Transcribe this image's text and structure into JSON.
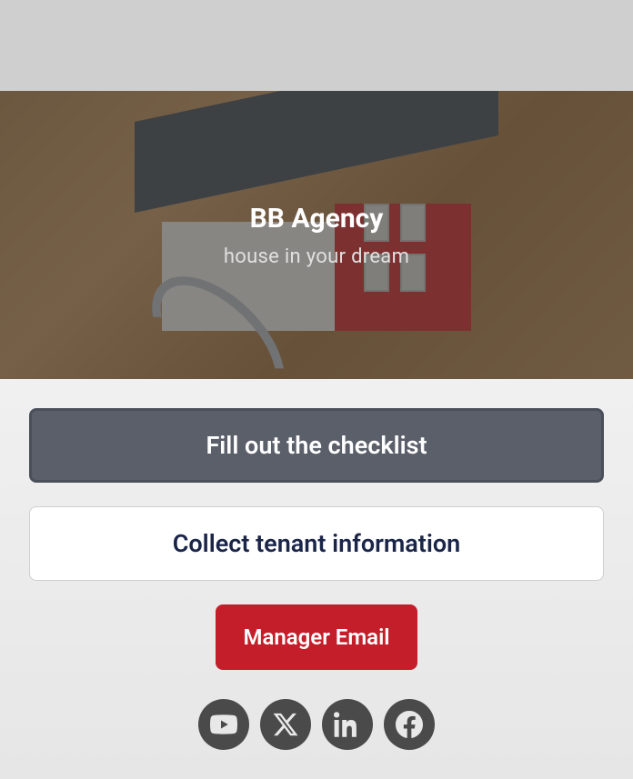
{
  "hero": {
    "title": "BB Agency",
    "subtitle": "house in your dream"
  },
  "buttons": {
    "checklist": "Fill out the checklist",
    "tenant": "Collect tenant information",
    "email": "Manager Email"
  },
  "socials": {
    "youtube": "youtube",
    "x": "x",
    "linkedin": "linkedin",
    "facebook": "facebook"
  }
}
